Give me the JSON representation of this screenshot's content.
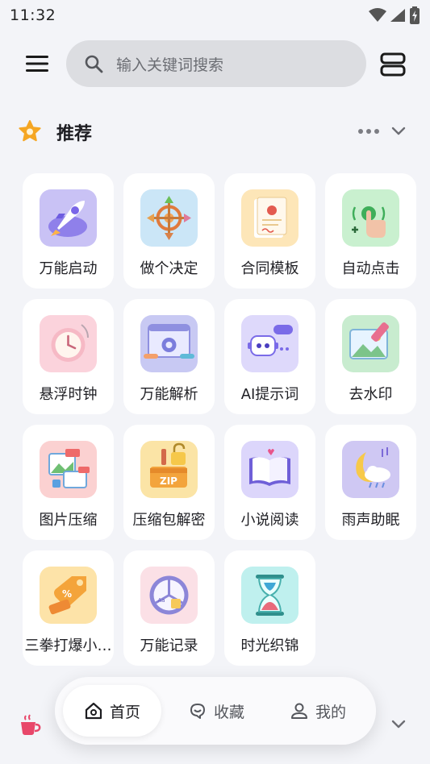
{
  "status_bar": {
    "time": "11:32"
  },
  "search": {
    "placeholder": "输入关键词搜索"
  },
  "section": {
    "title": "推荐"
  },
  "apps": [
    {
      "label": "万能启动",
      "icon": "rocket-icon"
    },
    {
      "label": "做个决定",
      "icon": "decision-wheel-icon"
    },
    {
      "label": "合同模板",
      "icon": "contract-icon"
    },
    {
      "label": "自动点击",
      "icon": "auto-click-icon"
    },
    {
      "label": "悬浮时钟",
      "icon": "clock-icon"
    },
    {
      "label": "万能解析",
      "icon": "parse-gear-icon"
    },
    {
      "label": "AI提示词",
      "icon": "ai-prompt-robot-icon"
    },
    {
      "label": "去水印",
      "icon": "remove-watermark-icon"
    },
    {
      "label": "图片压缩",
      "icon": "image-compress-icon"
    },
    {
      "label": "压缩包解密",
      "icon": "zip-unlock-icon"
    },
    {
      "label": "小说阅读",
      "icon": "book-icon"
    },
    {
      "label": "雨声助眠",
      "icon": "moon-rain-icon"
    },
    {
      "label": "三拳打爆小…",
      "icon": "tag-discount-icon"
    },
    {
      "label": "万能记录",
      "icon": "record-pie-icon"
    },
    {
      "label": "时光织锦",
      "icon": "hourglass-icon"
    }
  ],
  "bottom_nav": {
    "home": "首页",
    "favorites": "收藏",
    "mine": "我的"
  },
  "colors": {
    "background": "#f3f4f8",
    "search_bg": "#dcdde1",
    "star": "#f5a623",
    "cup": "#e8476a"
  }
}
